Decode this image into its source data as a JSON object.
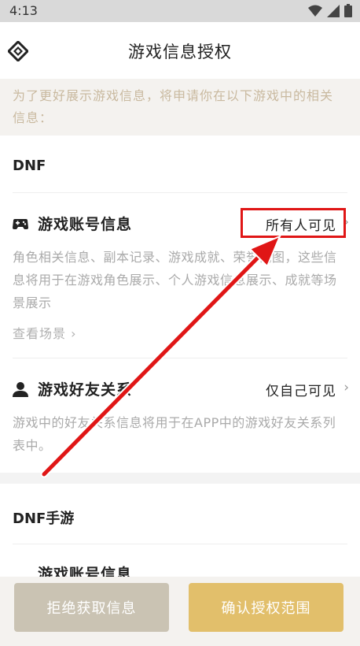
{
  "status_bar": {
    "time": "4:13"
  },
  "header": {
    "title": "游戏信息授权"
  },
  "intro": {
    "text": "为了更好展示游戏信息，将申请你在以下游戏中的相关信息："
  },
  "games": [
    {
      "title": "DNF",
      "permissions": [
        {
          "label": "游戏账号信息",
          "value": "所有人可见",
          "description": "角色相关信息、副本记录、游戏成就、荣誉截图，这些信息将用于在游戏角色展示、个人游戏信息展示、成就等场景展示",
          "view_link": "查看场景 ›"
        },
        {
          "label": "游戏好友关系",
          "value": "仅自己可见",
          "description": "游戏中的好友关系信息将用于在APP中的游戏好友关系列表中。"
        }
      ]
    },
    {
      "title": "DNF手游",
      "permissions": [
        {
          "label": "游戏账号信息"
        }
      ]
    }
  ],
  "buttons": {
    "reject": "拒绝获取信息",
    "confirm": "确认授权范围"
  },
  "colors": {
    "accent": "#e2bf6b",
    "annotation": "#e01616",
    "muted_button": "#cac3b3"
  },
  "icons": [
    "wifi-icon",
    "signal-icon",
    "battery-icon",
    "app-logo-icon",
    "gamepad-icon",
    "person-icon",
    "chevron-right-icon",
    "red-arrow-annotation"
  ]
}
